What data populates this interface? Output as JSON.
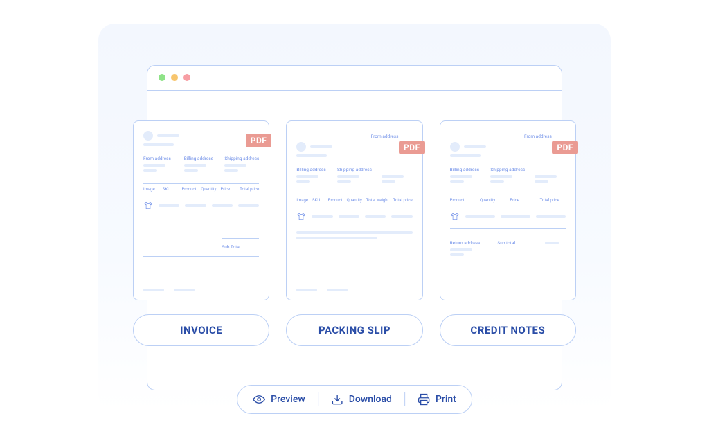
{
  "pdf_badge": "PDF",
  "cards": {
    "invoice": {
      "pill_label": "INVOICE",
      "addresses": [
        "From address",
        "Billing address",
        "Shipping address"
      ],
      "table_headers": [
        "Image",
        "SKU",
        "Product",
        "Quantity",
        "Price",
        "Total price"
      ],
      "subtotal_label": "Sub Total"
    },
    "packing": {
      "pill_label": "PACKING SLIP",
      "from_label": "From address",
      "addresses": [
        "Billing address",
        "Shipping address"
      ],
      "table_headers": [
        "Image",
        "SKU",
        "Product",
        "Quantity",
        "Total weight",
        "Total price"
      ]
    },
    "credit": {
      "pill_label": "CREDIT NOTES",
      "from_label": "From address",
      "addresses": [
        "Billing address",
        "Shipping address"
      ],
      "table_headers": [
        "Product",
        "Quantity",
        "Price",
        "Total price"
      ],
      "return_label": "Return address",
      "subtotal_label": "Sub total"
    }
  },
  "actions": {
    "preview": "Preview",
    "download": "Download",
    "print": "Print"
  }
}
